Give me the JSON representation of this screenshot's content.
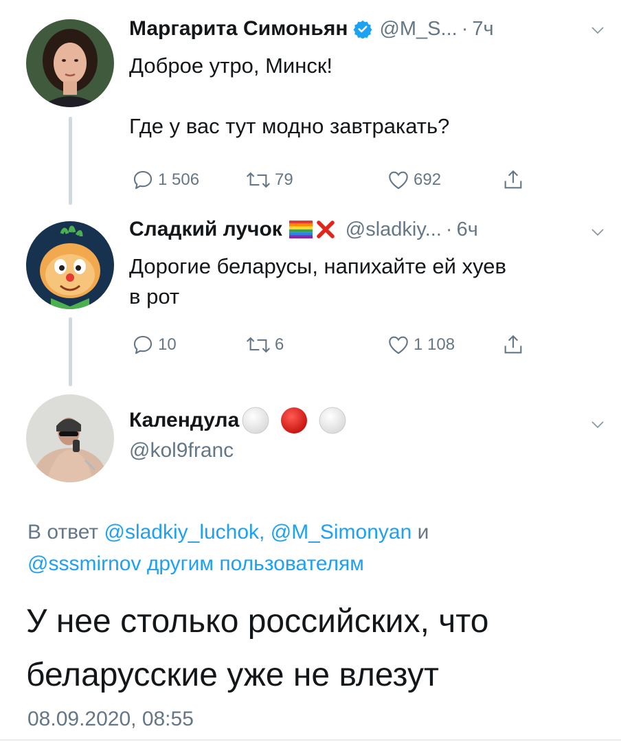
{
  "tweets": [
    {
      "name": "Маргарита Симоньян",
      "handle": "@M_S...",
      "separator": "·",
      "time": "7ч",
      "text_lines": [
        "Доброе утро, Минск!",
        "",
        "Где у вас тут модно завтракать?"
      ],
      "replies": "1 506",
      "retweets": "79",
      "likes": "692",
      "verified": true
    },
    {
      "name": "Сладкий лучок",
      "handle": "@sladkiy...",
      "separator": "·",
      "time": "6ч",
      "text_lines": [
        "Дорогие беларусы, напихайте ей хуев",
        "в рот"
      ],
      "replies": "10",
      "retweets": "6",
      "likes": "1 108"
    }
  ],
  "main_tweet": {
    "name": "Календула",
    "handle": "@kol9franc",
    "reply_prefix": "В ответ",
    "mention_1": "@sladkiy_luchok,",
    "mention_2": "@M_Simonyan",
    "conjunction": "и",
    "mention_3": "@sssmirnov",
    "others": "другим пользователям",
    "text_line_1": "У нее столько российских, что",
    "text_line_2": "беларусские уже не влезут",
    "timestamp": "08.09.2020, 08:55"
  },
  "colors": {
    "link": "#1da1f2",
    "secondary_text": "#657786",
    "verified": "#1da1f2",
    "thread_line": "#cfd9de"
  }
}
